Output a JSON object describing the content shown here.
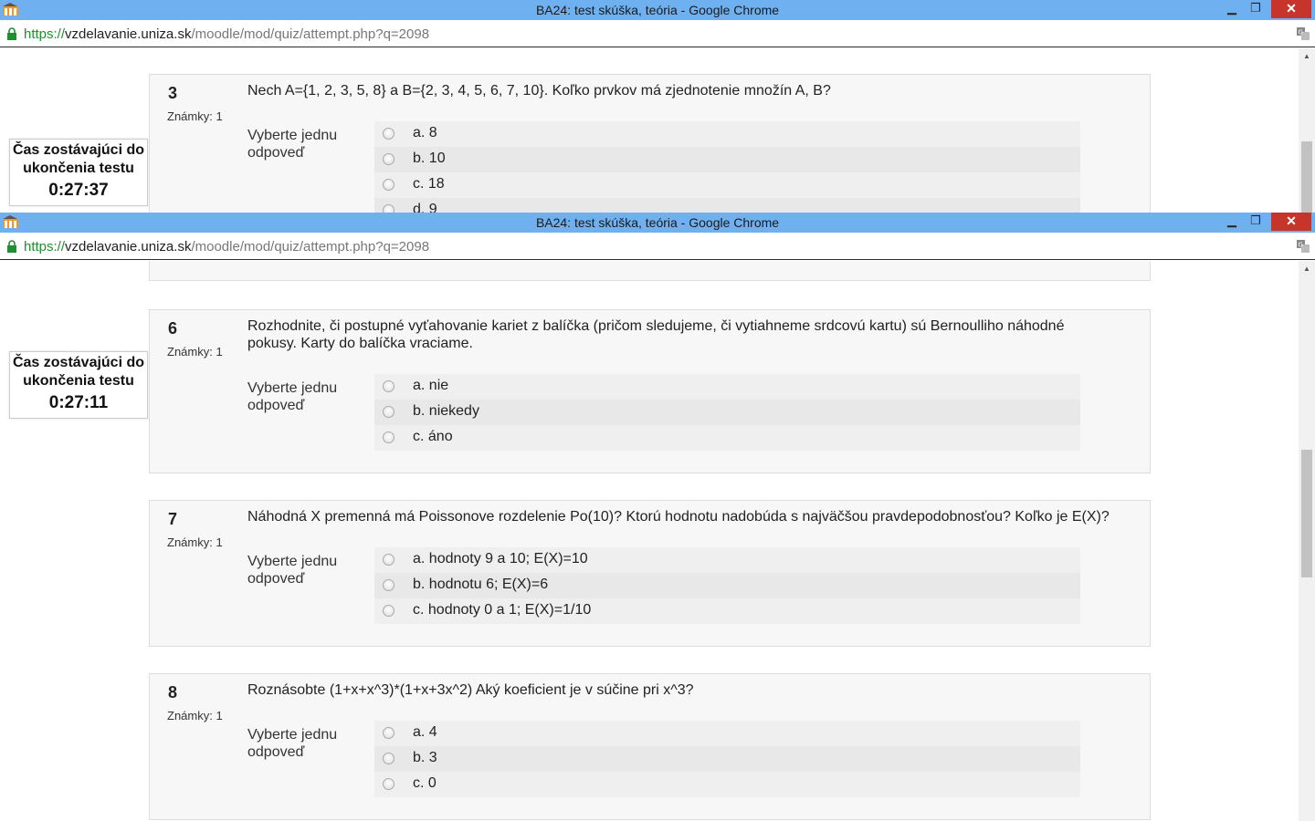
{
  "browser": {
    "window_title": "BA24: test skúška, teória - Google Chrome",
    "url_scheme": "https://",
    "url_host": "vzdelavanie.uniza.sk",
    "url_path": "/moodle/mod/quiz/attempt.php?q=2098",
    "min_glyph": "▁",
    "max_glyph": "❐",
    "close_glyph": "✕"
  },
  "timer_label": "Čas zostávajúci do ukončenia testu",
  "window1": {
    "timer_value": "0:27:37",
    "question": {
      "number": "3",
      "grade": "Známky: 1",
      "text": "Nech A={1, 2, 3, 5, 8} a B={2, 3, 4, 5, 6, 7, 10}. Koľko prvkov má zjednotenie množín A, B?",
      "prompt": "Vyberte jednu odpoveď",
      "answers": [
        "a. 8",
        "b. 10",
        "c. 18",
        "d. 9"
      ]
    }
  },
  "window2": {
    "timer_value": "0:27:11",
    "questions": [
      {
        "number": "6",
        "grade": "Známky: 1",
        "text": "Rozhodnite, či postupné vyťahovanie kariet z balíčka (pričom sledujeme, či vytiahneme srdcovú kartu) sú Bernoulliho náhodné pokusy. Karty do balíčka vraciame.",
        "prompt": "Vyberte jednu odpoveď",
        "answers": [
          "a. nie",
          "b. niekedy",
          "c. áno"
        ]
      },
      {
        "number": "7",
        "grade": "Známky: 1",
        "text": "Náhodná X premenná má Poissonove rozdelenie Po(10)? Ktorú hodnotu nadobúda s najväčšou pravdepodobnosťou? Koľko je E(X)?",
        "prompt": "Vyberte jednu odpoveď",
        "answers": [
          "a. hodnoty 9 a 10; E(X)=10",
          "b. hodnotu 6; E(X)=6",
          "c. hodnoty 0 a 1; E(X)=1/10"
        ]
      },
      {
        "number": "8",
        "grade": "Známky: 1",
        "text": "Roznásobte (1+x+x^3)*(1+x+3x^2) Aký koeficient je v súčine pri x^3?",
        "prompt": "Vyberte jednu odpoveď",
        "answers": [
          "a. 4",
          "b. 3",
          "c. 0"
        ]
      }
    ]
  },
  "colors": {
    "titlebar": "#6fb0f0",
    "close_button": "#c7342b",
    "url_scheme": "#1f8f2f"
  }
}
